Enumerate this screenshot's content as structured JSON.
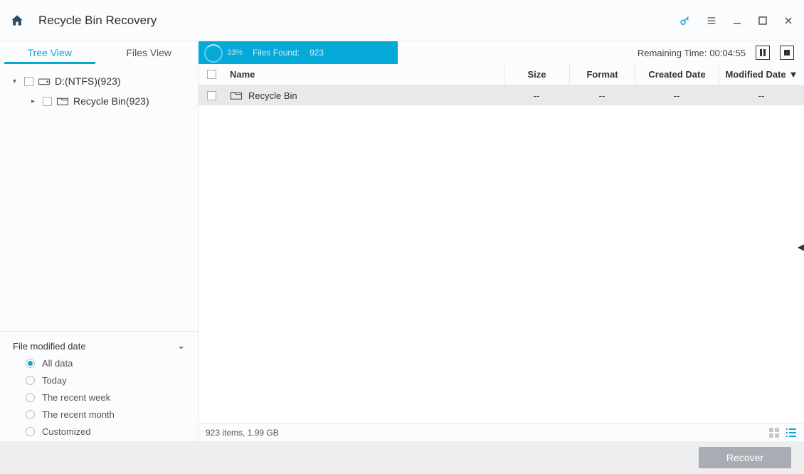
{
  "titlebar": {
    "title": "Recycle Bin Recovery"
  },
  "tabs": {
    "tree": "Tree View",
    "files": "Files View"
  },
  "progress": {
    "pct": "33%",
    "label": "Files Found:",
    "count": "923"
  },
  "remaining": {
    "label": "Remaining Time:",
    "value": "00:04:55"
  },
  "tree": {
    "root": "D:(NTFS)(923)",
    "child": "Recycle Bin(923)"
  },
  "filter": {
    "title": "File modified date",
    "options": [
      "All data",
      "Today",
      "The recent week",
      "The recent month",
      "Customized"
    ],
    "selected": 0
  },
  "columns": {
    "name": "Name",
    "size": "Size",
    "format": "Format",
    "created": "Created Date",
    "modified": "Modified Date"
  },
  "rows": [
    {
      "name": "Recycle Bin",
      "size": "--",
      "format": "--",
      "created": "--",
      "modified": "--"
    }
  ],
  "status": {
    "summary": "923 items, 1.99 GB"
  },
  "footer": {
    "recover": "Recover"
  }
}
